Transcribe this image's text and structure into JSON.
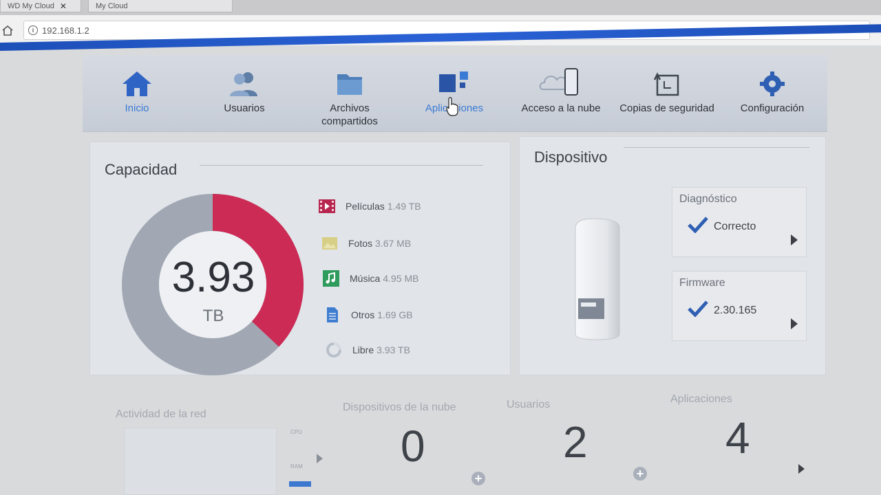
{
  "browser": {
    "tabs": [
      {
        "title": "WD My Cloud",
        "close": "✕"
      },
      {
        "title": "My Cloud"
      }
    ],
    "url": "192.168.1.2"
  },
  "nav": {
    "items": [
      {
        "label": "Inicio",
        "icon": "house-icon",
        "active": true
      },
      {
        "label": "Usuarios",
        "icon": "users-icon"
      },
      {
        "label": "Archivos compartidos",
        "icon": "folder-icon"
      },
      {
        "label": "Aplicaciones",
        "icon": "apps-icon"
      },
      {
        "label": "Acceso a la nube",
        "icon": "cloud-phone-icon"
      },
      {
        "label": "Copias de seguridad",
        "icon": "backup-icon"
      },
      {
        "label": "Configuración",
        "icon": "gear-icon"
      }
    ]
  },
  "capacity": {
    "title": "Capacidad",
    "total_value": "3.93",
    "total_unit": "TB",
    "used_fraction": 0.37,
    "colors": {
      "used": "#cc2b55",
      "free": "#a1a8b3"
    },
    "legend": [
      {
        "label": "Películas",
        "value": "1.49 TB",
        "icon": "film-icon",
        "color": "#b8264f"
      },
      {
        "label": "Fotos",
        "value": "3.67 MB",
        "icon": "photo-icon",
        "color": "#d8cf86"
      },
      {
        "label": "Música",
        "value": "4.95 MB",
        "icon": "music-icon",
        "color": "#2f9b5c"
      },
      {
        "label": "Otros",
        "value": "1.69 GB",
        "icon": "document-icon",
        "color": "#3f7dd0"
      },
      {
        "label": "Libre",
        "value": "3.93 TB",
        "icon": "pie-free-icon",
        "color": "#b9c0ca"
      }
    ]
  },
  "device": {
    "title": "Dispositivo",
    "diagnostics": {
      "label": "Diagnóstico",
      "status": "Correcto"
    },
    "firmware": {
      "label": "Firmware",
      "version": "2.30.165"
    }
  },
  "stats": {
    "network": {
      "label": "Actividad de la red",
      "cpu_label": "CPU",
      "ram_label": "RAM"
    },
    "cloud_devices": {
      "label": "Dispositivos de la nube",
      "value": "0"
    },
    "users": {
      "label": "Usuarios",
      "value": "2"
    },
    "apps": {
      "label": "Aplicaciones",
      "value": "4"
    }
  }
}
